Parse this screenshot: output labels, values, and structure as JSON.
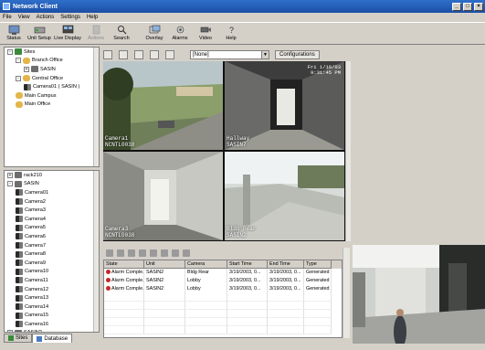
{
  "window": {
    "title": "Network Client"
  },
  "menu": [
    "File",
    "View",
    "Actions",
    "Settings",
    "Help"
  ],
  "toolbar": [
    {
      "label": "Status",
      "icon": "status-icon",
      "enabled": true
    },
    {
      "label": "Unit Setup",
      "icon": "unit-setup-icon",
      "enabled": true
    },
    {
      "label": "Live Display",
      "icon": "live-display-icon",
      "enabled": true
    },
    {
      "label": "Actions",
      "icon": "actions-icon",
      "enabled": false
    },
    {
      "label": "Search",
      "icon": "search-icon",
      "enabled": true
    },
    {
      "label": "Overlay",
      "icon": "overlay-icon",
      "enabled": true
    },
    {
      "label": "Alarms",
      "icon": "alarms-icon",
      "enabled": true
    },
    {
      "label": "Video",
      "icon": "video-icon",
      "enabled": true
    },
    {
      "label": "Help",
      "icon": "help-icon",
      "enabled": true
    }
  ],
  "sites_tree": [
    {
      "label": "Sites",
      "level": 0,
      "icon": "site",
      "expander": "-"
    },
    {
      "label": "Branch Office",
      "level": 1,
      "icon": "branch",
      "expander": "-"
    },
    {
      "label": "SASIN",
      "level": 2,
      "icon": "unit",
      "expander": "+"
    },
    {
      "label": "Central Office",
      "level": 1,
      "icon": "branch",
      "expander": "-"
    },
    {
      "label": "Camera01  ( SASIN )",
      "level": 2,
      "icon": "cam",
      "expander": ""
    },
    {
      "label": "Main Campus",
      "level": 1,
      "icon": "branch",
      "expander": ""
    },
    {
      "label": "Main Office",
      "level": 1,
      "icon": "branch",
      "expander": ""
    }
  ],
  "units_tree": [
    {
      "label": "rack210",
      "level": 0,
      "icon": "unit",
      "expander": "+"
    },
    {
      "label": "SASIN",
      "level": 0,
      "icon": "unit",
      "expander": "-"
    },
    {
      "label": "Camera01",
      "level": 1,
      "icon": "cam"
    },
    {
      "label": "Camera2",
      "level": 1,
      "icon": "cam"
    },
    {
      "label": "Camera3",
      "level": 1,
      "icon": "cam"
    },
    {
      "label": "Camera4",
      "level": 1,
      "icon": "cam"
    },
    {
      "label": "Camera5",
      "level": 1,
      "icon": "cam"
    },
    {
      "label": "Camera6",
      "level": 1,
      "icon": "cam"
    },
    {
      "label": "Camera7",
      "level": 1,
      "icon": "cam"
    },
    {
      "label": "Camera8",
      "level": 1,
      "icon": "cam"
    },
    {
      "label": "Camera9",
      "level": 1,
      "icon": "cam"
    },
    {
      "label": "Camera10",
      "level": 1,
      "icon": "cam"
    },
    {
      "label": "Camera11",
      "level": 1,
      "icon": "cam"
    },
    {
      "label": "Camera12",
      "level": 1,
      "icon": "cam"
    },
    {
      "label": "Camera13",
      "level": 1,
      "icon": "cam"
    },
    {
      "label": "Camera14",
      "level": 1,
      "icon": "cam"
    },
    {
      "label": "Camera15",
      "level": 1,
      "icon": "cam"
    },
    {
      "label": "Camera16",
      "level": 1,
      "icon": "cam"
    },
    {
      "label": "SASIN2",
      "level": 0,
      "icon": "unit",
      "expander": "+"
    }
  ],
  "bottom_tabs": [
    {
      "label": "Sites",
      "active": false
    },
    {
      "label": "Database",
      "active": true
    }
  ],
  "video": {
    "layout_value": "[None]",
    "config_label": "Configurations",
    "tiles": [
      {
        "name": "Camera1",
        "unit": "NCNTL0038",
        "ts": ""
      },
      {
        "name": "Hallway",
        "unit": "SASIN7",
        "ts": "Fri 1/10/03\n9:31:45 PM"
      },
      {
        "name": "Camera3",
        "unit": "NCNTL0038",
        "ts": ""
      },
      {
        "name": "Bldg Rear",
        "unit": "SASIN2",
        "ts": ""
      }
    ]
  },
  "alarm_table": {
    "headers": [
      "State",
      "Unit",
      "Camera",
      "Start Time",
      "End Time",
      "Type"
    ],
    "rows": [
      [
        "Alarm Comple...",
        "SASIN2",
        "Bldg Rear",
        "3/19/2003, 0...",
        "3/19/2003, 0...",
        "Generated"
      ],
      [
        "Alarm Comple...",
        "SASIN2",
        "Lobby",
        "3/19/2003, 0...",
        "3/19/2003, 0...",
        "Generated"
      ],
      [
        "Alarm Comple...",
        "SASIN2",
        "Lobby",
        "3/19/2003, 0...",
        "3/19/2003, 0...",
        "Generated"
      ]
    ]
  },
  "colors": {
    "title_bar": "#1b4ea5",
    "panel_bg": "#d4d0c8",
    "alarm": "#c62828"
  }
}
